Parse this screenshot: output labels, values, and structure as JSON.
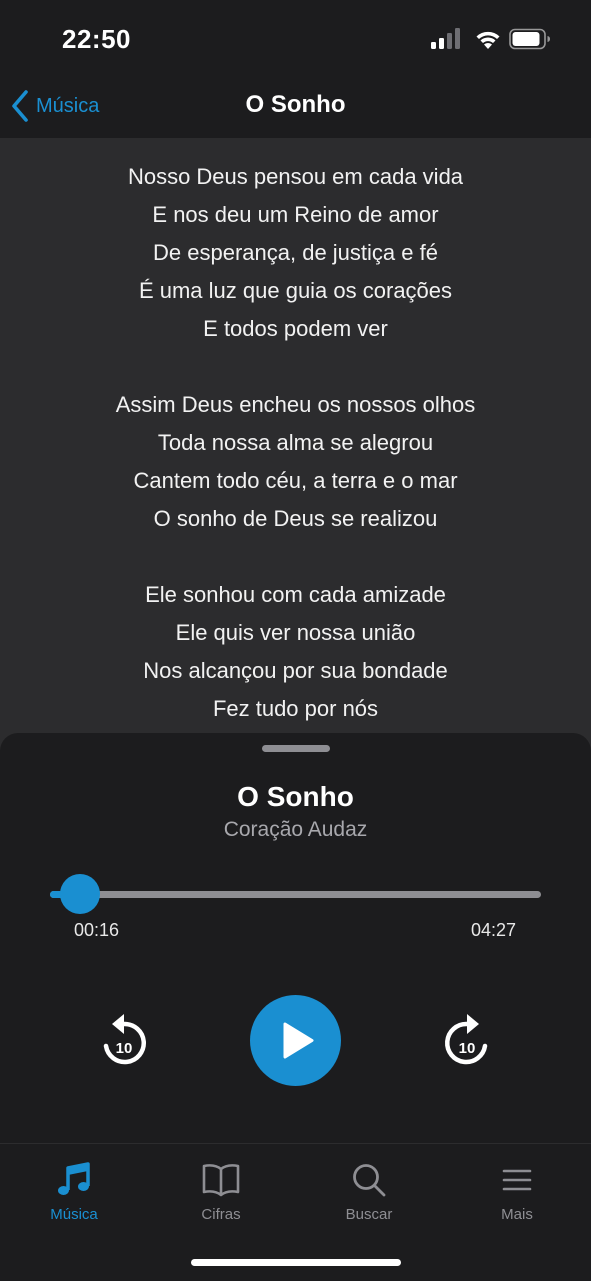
{
  "status_bar": {
    "time": "22:50",
    "icons": [
      "cellular-signal-icon",
      "wifi-icon",
      "battery-icon"
    ]
  },
  "nav": {
    "back_label": "Música",
    "title": "O Sonho"
  },
  "lyrics": {
    "stanzas": [
      [
        "Nosso Deus pensou em cada vida",
        "E nos deu um Reino de amor",
        "De esperança, de justiça e fé",
        "É uma luz que guia os corações",
        "E todos podem ver"
      ],
      [
        "Assim Deus encheu os nossos olhos",
        "Toda nossa alma se alegrou",
        "Cantem todo céu, a terra e o mar",
        "O sonho de Deus se realizou"
      ],
      [
        "Ele sonhou com cada amizade",
        "Ele quis ver nossa união",
        "Nos alcançou por sua bondade",
        "Fez tudo por nós"
      ]
    ]
  },
  "player": {
    "title": "O Sonho",
    "artist": "Coração Audaz",
    "elapsed": "00:16",
    "duration": "04:27",
    "progress_fraction": 0.062,
    "skip_seconds": "10",
    "icons": [
      "rewind-10-icon",
      "play-icon",
      "forward-10-icon"
    ]
  },
  "tabs": [
    {
      "label": "Música",
      "icon": "music-note-icon",
      "active": true
    },
    {
      "label": "Cifras",
      "icon": "book-icon",
      "active": false
    },
    {
      "label": "Buscar",
      "icon": "search-icon",
      "active": false
    },
    {
      "label": "Mais",
      "icon": "menu-icon",
      "active": false
    }
  ],
  "colors": {
    "accent": "#1a8fd1",
    "background": "#1c1c1e",
    "lyrics_background": "#2c2c2e",
    "muted": "#8e8e93"
  }
}
